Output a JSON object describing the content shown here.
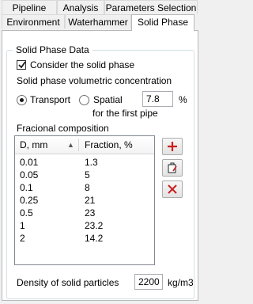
{
  "tabs_row1": [
    "Pipeline",
    "Analysis",
    "Parameters Selection"
  ],
  "tabs_row2": [
    "Environment",
    "Waterhammer",
    "Solid Phase"
  ],
  "active_tab": "Solid Phase",
  "group": {
    "title": "Solid Phase Data",
    "consider_label": "Consider the solid phase",
    "consider_checked": true,
    "concentration_label": "Solid phase volumetric concentration",
    "radio_transport": "Transport",
    "radio_spatial": "Spatial",
    "spatial_note": "for the first pipe",
    "selected_mode": "Transport",
    "concentration_value": "7.8",
    "concentration_unit": "%",
    "composition_label": "Fracional composition",
    "table": {
      "columns": [
        "D, mm",
        "Fraction, %"
      ],
      "sort_indicator": "▲",
      "rows": [
        [
          "0.01",
          "1.3"
        ],
        [
          "0.05",
          "5"
        ],
        [
          "0.1",
          "8"
        ],
        [
          "0.25",
          "21"
        ],
        [
          "0.5",
          "23"
        ],
        [
          "1",
          "23.2"
        ],
        [
          "2",
          "14.2"
        ]
      ]
    },
    "buttons": [
      "add-icon",
      "edit-icon",
      "delete-icon"
    ],
    "density_label": "Density of solid particles",
    "density_value": "2200",
    "density_unit": "kg/m3"
  },
  "colors": {
    "accent_red": "#cc1f1f",
    "panel_border": "#b9b9b9",
    "group_border": "#d5dfe5"
  }
}
